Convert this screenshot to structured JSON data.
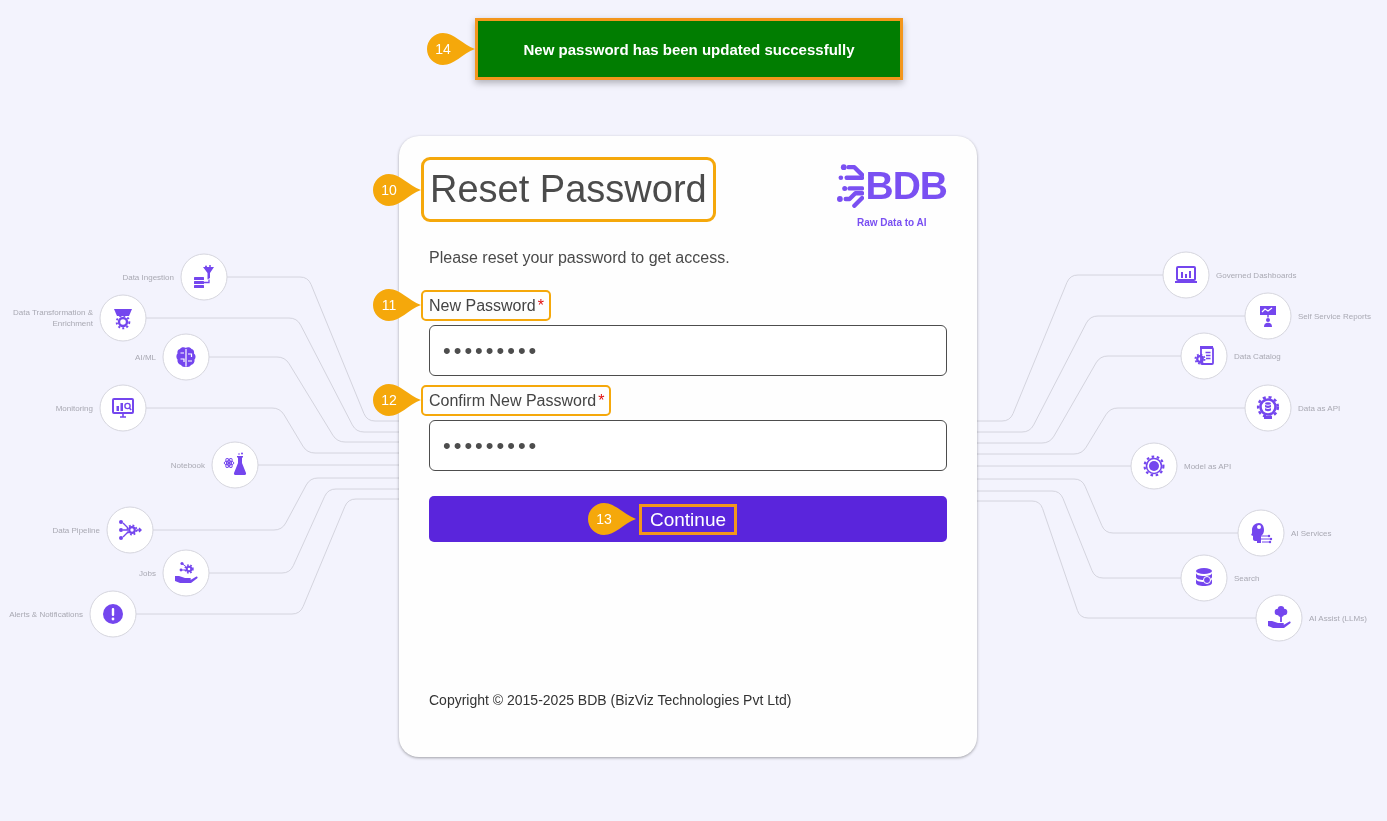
{
  "toast": {
    "message": "New password has been updated successfully",
    "callout": "14"
  },
  "diagram": {
    "left_nodes": [
      {
        "label": "Data Ingestion"
      },
      {
        "label": "Data Transformation & Enrichment"
      },
      {
        "label": "AI/ML"
      },
      {
        "label": "Monitoring"
      },
      {
        "label": "Notebook"
      },
      {
        "label": "Data Pipeline"
      },
      {
        "label": "Jobs"
      },
      {
        "label": "Alerts & Notifications"
      }
    ],
    "right_nodes": [
      {
        "label": "Governed Dashboards"
      },
      {
        "label": "Self Service Reports"
      },
      {
        "label": "Data Catalog"
      },
      {
        "label": "Data as API"
      },
      {
        "label": "Model as API"
      },
      {
        "label": "AI Services"
      },
      {
        "label": "Search"
      },
      {
        "label": "AI Assist (LLMs)"
      }
    ]
  },
  "card": {
    "title": {
      "text": "Reset Password",
      "callout": "10"
    },
    "logo": {
      "wordmark": "BDB",
      "tagline": "Raw Data to AI"
    },
    "subtitle": "Please reset your password to get access.",
    "fields": [
      {
        "label": "New Password",
        "required_mark": "*",
        "value": "•••••••••",
        "callout": "11"
      },
      {
        "label": "Confirm New Password",
        "required_mark": "*",
        "value": "•••••••••",
        "callout": "12"
      }
    ],
    "button": {
      "label": "Continue",
      "callout": "13"
    },
    "copyright": "Copyright © 2015-2025 BDB (BizViz Technologies Pvt Ltd)"
  }
}
